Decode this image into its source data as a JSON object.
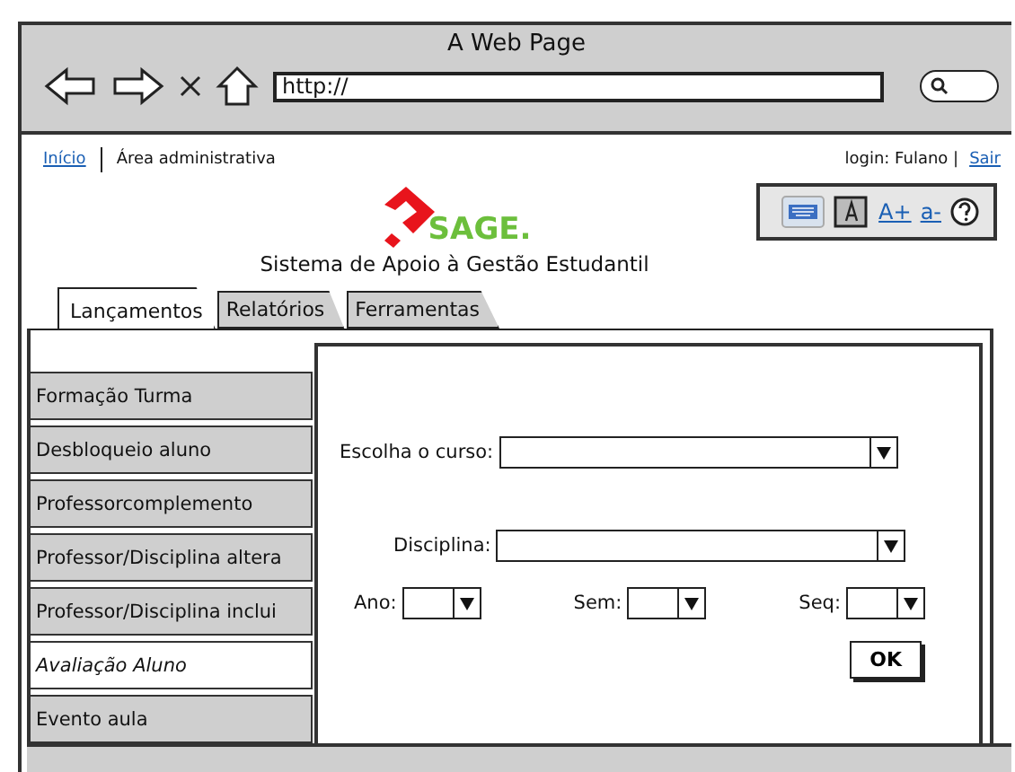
{
  "window": {
    "title": "A Web Page",
    "url": "http://"
  },
  "header": {
    "home_link": "Início",
    "section": "Área administrativa",
    "login": "login: Fulano |",
    "logout_link": "Sair"
  },
  "logo": {
    "text": "SAGE.",
    "subtitle": "Sistema de Apoio à Gestão Estudantil"
  },
  "accessibility": {
    "font_increase": "A+",
    "font_decrease": "a-"
  },
  "tabs": [
    {
      "label": "Lançamentos",
      "selected": true
    },
    {
      "label": "Relatórios",
      "selected": false
    },
    {
      "label": "Ferramentas",
      "selected": false
    }
  ],
  "sidebar": {
    "items": [
      {
        "label": "Formação Turma",
        "selected": false
      },
      {
        "label": "Desbloqueio aluno",
        "selected": false
      },
      {
        "label": "Professorcomplemento",
        "selected": false
      },
      {
        "label": "Professor/Disciplina altera",
        "selected": false
      },
      {
        "label": "Professor/Disciplina inclui",
        "selected": false
      },
      {
        "label": "Avaliação Aluno",
        "selected": true
      },
      {
        "label": "Evento aula",
        "selected": false
      }
    ]
  },
  "form": {
    "course_label": "Escolha o curso:",
    "discipline_label": "Disciplina:",
    "small_selects": [
      {
        "label": "Ano:"
      },
      {
        "label": "Sem:"
      },
      {
        "label": "Seq:"
      }
    ],
    "ok_button": "OK"
  }
}
